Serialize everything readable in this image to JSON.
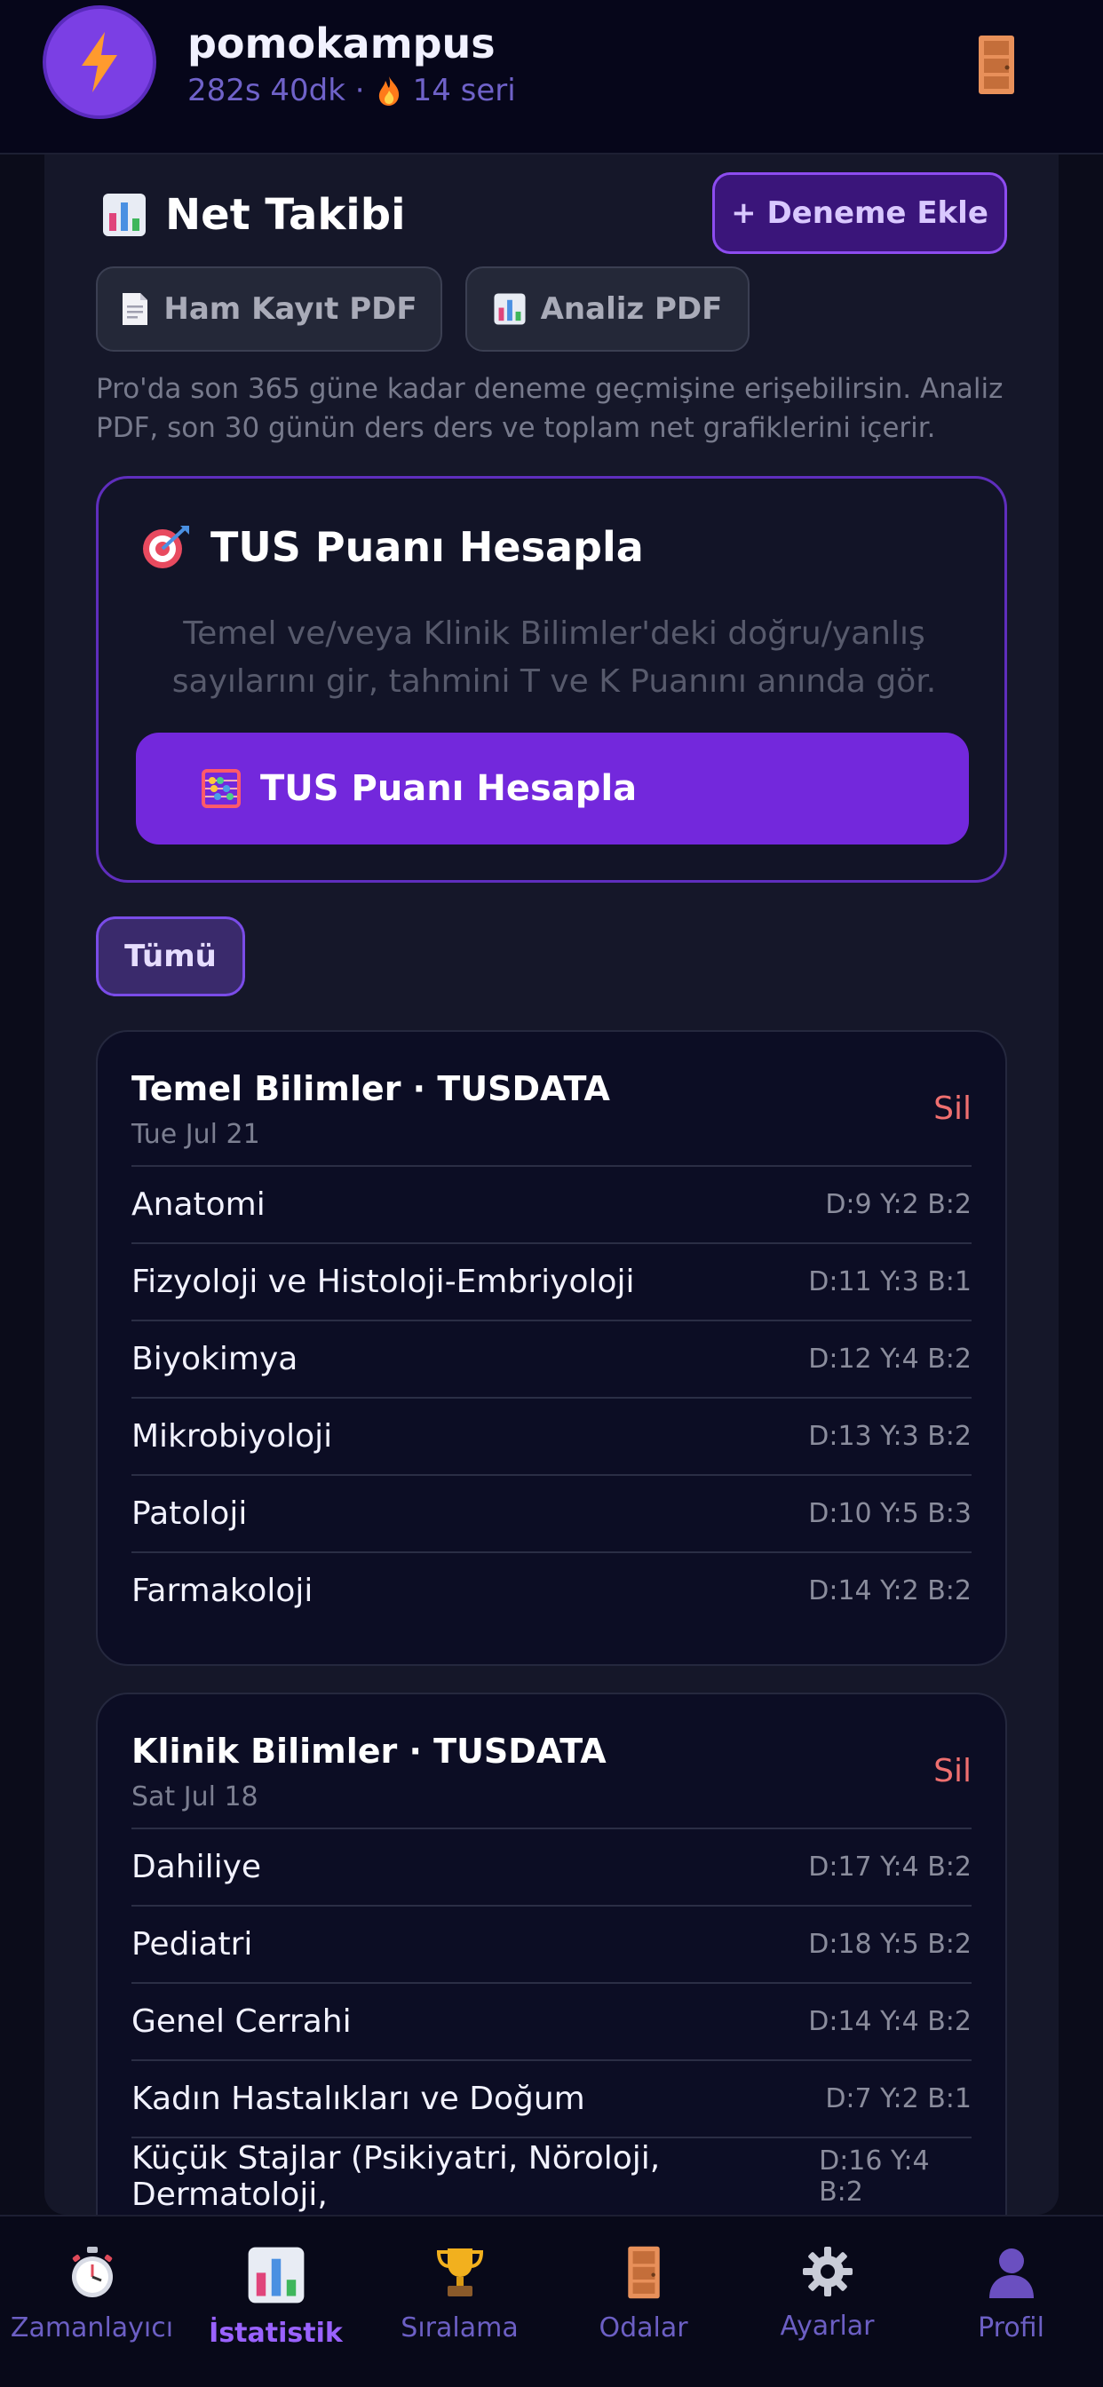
{
  "header": {
    "app_name": "pomokampus",
    "hours": "282s 40dk ·",
    "streak": "14 seri"
  },
  "net_takibi": {
    "title": "Net Takibi",
    "add_label": "+ Deneme Ekle",
    "raw_pdf_label": "Ham Kayıt PDF",
    "analysis_pdf_label": "Analiz PDF",
    "info": "Pro'da son 365 güne kadar deneme geçmişine erişebilirsin. Analiz PDF, son 30 günün ders ders ve toplam net grafiklerini içerir."
  },
  "tus": {
    "title": "TUS Puanı Hesapla",
    "description": "Temel ve/veya Klinik Bilimler'deki doğru/yanlış sayılarını gir, tahmini T ve K Puanını anında gör.",
    "button_label": "TUS Puanı Hesapla"
  },
  "filter": {
    "all_label": "Tümü"
  },
  "exams": [
    {
      "title": "Temel Bilimler · TUSDATA",
      "date": "Tue Jul 21",
      "delete_label": "Sil",
      "subjects": [
        {
          "name": "Anatomi",
          "score": "D:9 Y:2 B:2"
        },
        {
          "name": "Fizyoloji ve Histoloji-Embriyoloji",
          "score": "D:11 Y:3 B:1"
        },
        {
          "name": "Biyokimya",
          "score": "D:12 Y:4 B:2"
        },
        {
          "name": "Mikrobiyoloji",
          "score": "D:13 Y:3 B:2"
        },
        {
          "name": "Patoloji",
          "score": "D:10 Y:5 B:3"
        },
        {
          "name": "Farmakoloji",
          "score": "D:14 Y:2 B:2"
        }
      ]
    },
    {
      "title": "Klinik Bilimler · TUSDATA",
      "date": "Sat Jul 18",
      "delete_label": "Sil",
      "subjects": [
        {
          "name": "Dahiliye",
          "score": "D:17 Y:4 B:2"
        },
        {
          "name": "Pediatri",
          "score": "D:18 Y:5 B:2"
        },
        {
          "name": "Genel Cerrahi",
          "score": "D:14 Y:4 B:2"
        },
        {
          "name": "Kadın Hastalıkları ve Doğum",
          "score": "D:7 Y:2 B:1"
        },
        {
          "name": "Küçük Stajlar (Psikiyatri, Nöroloji, Dermatoloji,",
          "score": "D:16 Y:4 B:2"
        }
      ]
    }
  ],
  "nav": {
    "timer": "Zamanlayıcı",
    "stats": "İstatistik",
    "ranking": "Sıralama",
    "rooms": "Odalar",
    "settings": "Ayarlar",
    "profile": "Profil"
  },
  "colors": {
    "accent": "#7328dc",
    "background": "#0b0c1a",
    "delete": "#ef6f6f",
    "active_nav": "#9a62ff"
  },
  "icons": {
    "avatar": "lightning-icon",
    "rooms_top": "door-icon",
    "net_takibi": "bar-chart-icon",
    "tus": "target-icon",
    "tus_button": "abacus-icon"
  }
}
